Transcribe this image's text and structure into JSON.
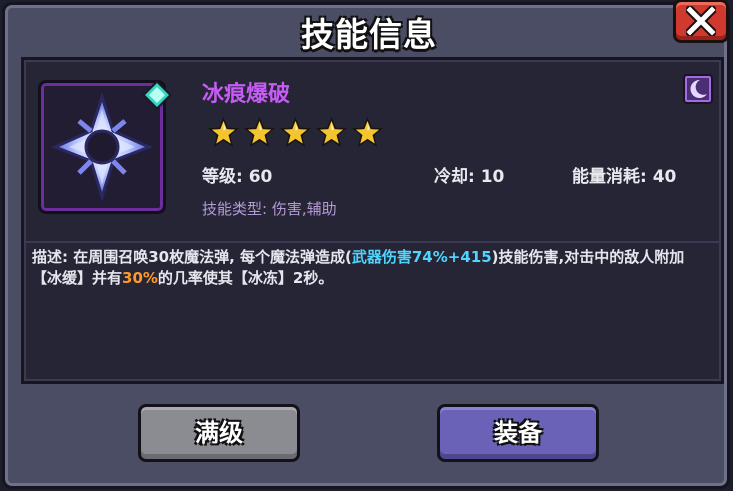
{
  "dialog": {
    "title": "技能信息"
  },
  "skill": {
    "name": "冰痕爆破",
    "star_count": 5,
    "level_text": "等级: 60",
    "cooldown_text": "冷却: 10",
    "energy_text": "能量消耗: 40",
    "type_text": "技能类型: 伤害,辅助",
    "description": {
      "part1": "描述: 在周围召唤30枚魔法弹, 每个魔法弹造成(",
      "weapon_damage": "武器伤害74%+415",
      "part2": ")技能伤害,对击中的敌人附加【冰缓】并有",
      "chance": "30%",
      "part3": "的几率使其【冰冻】2秒。"
    }
  },
  "buttons": {
    "max_level": "满级",
    "equip": "装备"
  },
  "icons": {
    "close": "close-icon",
    "skill_art": "ice-shuriken-icon",
    "gem": "cyan-gem-icon",
    "type_badge": "crescent-moon-icon",
    "star": "star-icon"
  },
  "colors": {
    "skill_name": "#c65cf5",
    "weapon_damage_highlight": "#4fd6ff",
    "chance_highlight": "#ff9a2a",
    "close_button": "#d03a2e",
    "equip_button": "#6a62b6",
    "max_button": "#8b8b92",
    "star": "#f5c531"
  }
}
